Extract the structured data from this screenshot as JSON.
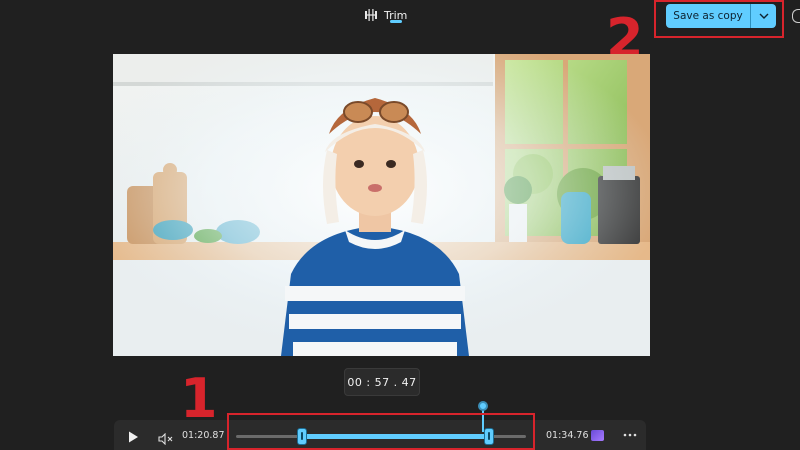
{
  "toolbar": {
    "tab_trim_label": "Trim",
    "save_label": "Save as copy"
  },
  "annotations": {
    "step_1": "1",
    "step_2": "2"
  },
  "player": {
    "current_time": "00 : 57 . 47",
    "trim_start": "01:20.87",
    "trim_end": "01:34.76"
  },
  "timeline": {
    "selection_start_fraction": 0.23,
    "selection_end_fraction": 0.87,
    "playhead_fraction": 0.85
  },
  "colors": {
    "accent": "#60cdff",
    "annotation": "#d7242c",
    "background": "#202020",
    "panel": "#2b2b2b"
  },
  "icons": {
    "trim": "trim-icon",
    "chevron": "chevron-down-icon",
    "play": "play-icon",
    "mute": "volume-mute-icon",
    "clip": "clip-thumbnail-icon",
    "more": "more-icon"
  }
}
